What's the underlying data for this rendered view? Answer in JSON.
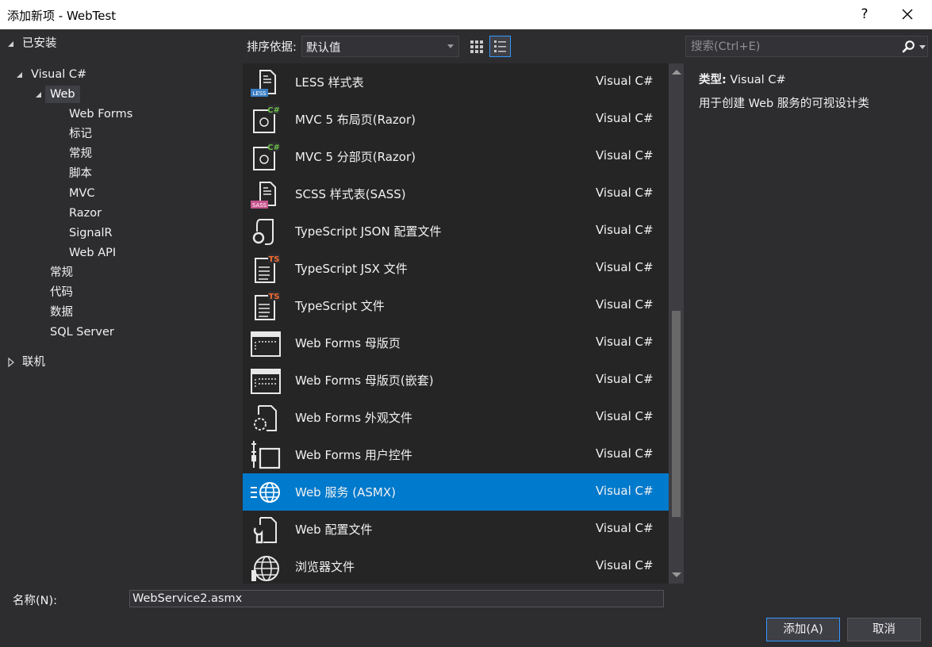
{
  "window": {
    "title": "添加新项 - WebTest",
    "help_label": "?"
  },
  "tree": {
    "installed": "已安装",
    "visual_csharp": "Visual C#",
    "web": "Web",
    "web_children": [
      "Web Forms",
      "标记",
      "常规",
      "脚本",
      "MVC",
      "Razor",
      "SignalR",
      "Web API"
    ],
    "csharp_children": [
      "常规",
      "代码",
      "数据",
      "SQL Server"
    ],
    "online": "联机"
  },
  "toolbar": {
    "sort_label": "排序依据:",
    "sort_value": "默认值"
  },
  "search": {
    "placeholder": "搜索(Ctrl+E)"
  },
  "templates": [
    {
      "name": "LESS 样式表",
      "lang": "Visual C#",
      "icon": "less-file-icon"
    },
    {
      "name": "MVC 5 布局页(Razor)",
      "lang": "Visual C#",
      "icon": "razor-layout-icon"
    },
    {
      "name": "MVC 5 分部页(Razor)",
      "lang": "Visual C#",
      "icon": "razor-partial-icon"
    },
    {
      "name": "SCSS 样式表(SASS)",
      "lang": "Visual C#",
      "icon": "sass-file-icon"
    },
    {
      "name": "TypeScript JSON 配置文件",
      "lang": "Visual C#",
      "icon": "json-config-icon"
    },
    {
      "name": "TypeScript JSX 文件",
      "lang": "Visual C#",
      "icon": "typescript-jsx-icon"
    },
    {
      "name": "TypeScript 文件",
      "lang": "Visual C#",
      "icon": "typescript-file-icon"
    },
    {
      "name": "Web Forms 母版页",
      "lang": "Visual C#",
      "icon": "master-page-icon"
    },
    {
      "name": "Web Forms 母版页(嵌套)",
      "lang": "Visual C#",
      "icon": "nested-master-page-icon"
    },
    {
      "name": "Web Forms 外观文件",
      "lang": "Visual C#",
      "icon": "skin-file-icon"
    },
    {
      "name": "Web Forms 用户控件",
      "lang": "Visual C#",
      "icon": "user-control-icon"
    },
    {
      "name": "Web 服务 (ASMX)",
      "lang": "Visual C#",
      "icon": "web-service-icon",
      "selected": true
    },
    {
      "name": "Web 配置文件",
      "lang": "Visual C#",
      "icon": "web-config-icon"
    },
    {
      "name": "浏览器文件",
      "lang": "Visual C#",
      "icon": "browser-file-icon"
    }
  ],
  "description": {
    "type_label": "类型:",
    "type_value": "Visual C#",
    "text": "用于创建 Web 服务的可视设计类"
  },
  "footer": {
    "name_label": "名称(N):",
    "name_value": "WebService2.asmx",
    "add_button": "添加(A)",
    "cancel_button": "取消"
  },
  "colors": {
    "background": "#2d2d30",
    "list_background": "#252526",
    "selection": "#007acc",
    "accent_border": "#3399ff"
  }
}
